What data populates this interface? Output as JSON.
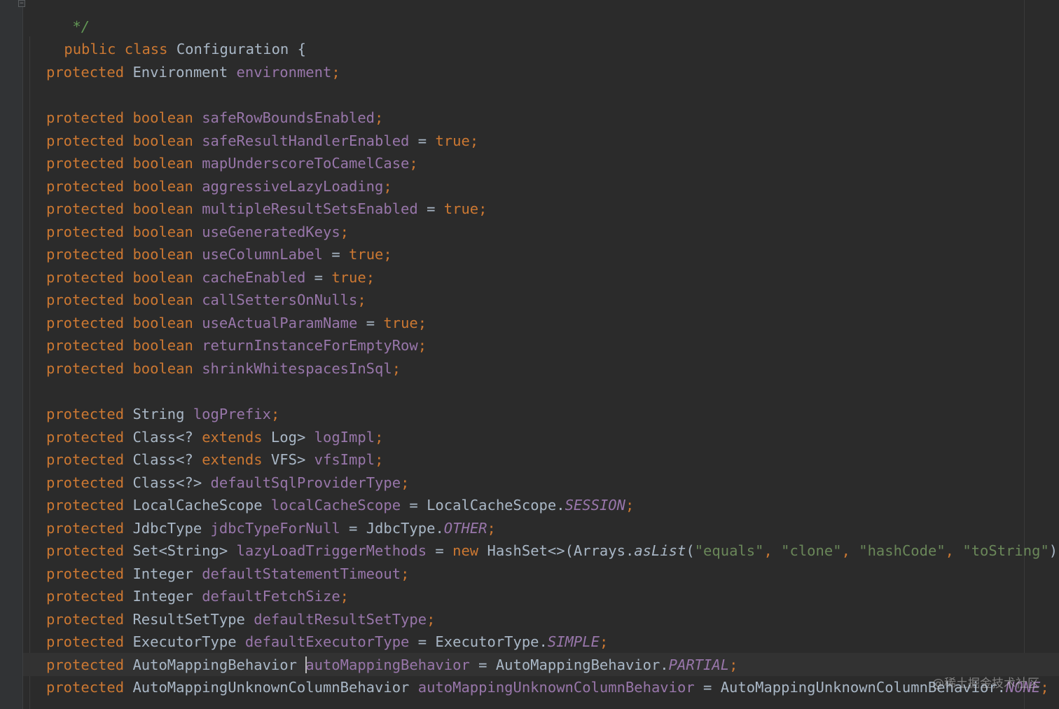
{
  "editor": {
    "comment_end": "*/",
    "class_decl": {
      "modifiers": "public class",
      "name": "Configuration",
      "brace": "{"
    },
    "fields": [
      {
        "mod": "protected",
        "type": "Environment",
        "name": "environment"
      },
      {
        "mod": "protected",
        "type": "boolean",
        "name": "safeRowBoundsEnabled"
      },
      {
        "mod": "protected",
        "type": "boolean",
        "name": "safeResultHandlerEnabled",
        "value": "true"
      },
      {
        "mod": "protected",
        "type": "boolean",
        "name": "mapUnderscoreToCamelCase"
      },
      {
        "mod": "protected",
        "type": "boolean",
        "name": "aggressiveLazyLoading"
      },
      {
        "mod": "protected",
        "type": "boolean",
        "name": "multipleResultSetsEnabled",
        "value": "true"
      },
      {
        "mod": "protected",
        "type": "boolean",
        "name": "useGeneratedKeys"
      },
      {
        "mod": "protected",
        "type": "boolean",
        "name": "useColumnLabel",
        "value": "true"
      },
      {
        "mod": "protected",
        "type": "boolean",
        "name": "cacheEnabled",
        "value": "true"
      },
      {
        "mod": "protected",
        "type": "boolean",
        "name": "callSettersOnNulls"
      },
      {
        "mod": "protected",
        "type": "boolean",
        "name": "useActualParamName",
        "value": "true"
      },
      {
        "mod": "protected",
        "type": "boolean",
        "name": "returnInstanceForEmptyRow"
      },
      {
        "mod": "protected",
        "type": "boolean",
        "name": "shrinkWhitespacesInSql"
      },
      {
        "mod": "protected",
        "type": "String",
        "name": "logPrefix"
      },
      {
        "mod": "protected",
        "type_pre": "Class<? ",
        "type_kw": "extends",
        "type_post": " Log>",
        "name": "logImpl"
      },
      {
        "mod": "protected",
        "type_pre": "Class<? ",
        "type_kw": "extends",
        "type_post": " VFS>",
        "name": "vfsImpl"
      },
      {
        "mod": "protected",
        "type": "Class<?>",
        "name": "defaultSqlProviderType"
      },
      {
        "mod": "protected",
        "type": "LocalCacheScope",
        "name": "localCacheScope",
        "enum_cls": "LocalCacheScope.",
        "enum_val": "SESSION"
      },
      {
        "mod": "protected",
        "type": "JdbcType",
        "name": "jdbcTypeForNull",
        "enum_cls": "JdbcType.",
        "enum_val": "OTHER"
      },
      {
        "mod": "protected",
        "type": "Set<String>",
        "name": "lazyLoadTriggerMethods",
        "new_kw": "new",
        "ctor": "HashSet<>(Arrays.",
        "method": "asList",
        "args": [
          "\"equals\"",
          "\"clone\"",
          "\"hashCode\"",
          "\"toString\""
        ],
        "close": "))"
      },
      {
        "mod": "protected",
        "type": "Integer",
        "name": "defaultStatementTimeout"
      },
      {
        "mod": "protected",
        "type": "Integer",
        "name": "defaultFetchSize"
      },
      {
        "mod": "protected",
        "type": "ResultSetType",
        "name": "defaultResultSetType"
      },
      {
        "mod": "protected",
        "type": "ExecutorType",
        "name": "defaultExecutorType",
        "enum_cls": "ExecutorType.",
        "enum_val": "SIMPLE"
      },
      {
        "mod": "protected",
        "type": "AutoMappingBehavior",
        "name": "autoMappingBehavior",
        "enum_cls": "AutoMappingBehavior.",
        "enum_val": "PARTIAL"
      },
      {
        "mod": "protected",
        "type": "AutoMappingUnknownColumnBehavior",
        "name": "autoMappingUnknownColumnBehavior",
        "enum_cls": "AutoMappingUnknownColumnBehavior.",
        "enum_val": "NONE"
      }
    ]
  },
  "watermark": "@稀土掘金技术社区"
}
